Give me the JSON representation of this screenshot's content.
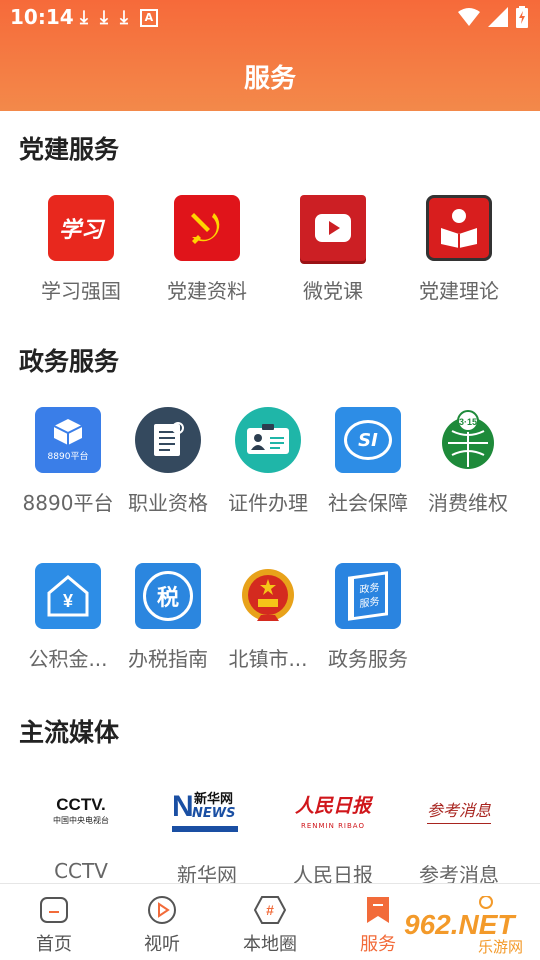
{
  "status_bar": {
    "time": "10:14"
  },
  "header": {
    "title": "服务"
  },
  "sections": [
    {
      "title": "党建服务",
      "items": [
        {
          "label": "学习强国",
          "icon": "xuexi-qiangguo-icon"
        },
        {
          "label": "党建资料",
          "icon": "party-emblem-icon"
        },
        {
          "label": "微党课",
          "icon": "video-play-icon"
        },
        {
          "label": "党建理论",
          "icon": "reading-person-icon"
        }
      ]
    },
    {
      "title": "政务服务",
      "items": [
        {
          "label": "8890平台",
          "icon": "cube-box-icon",
          "icon_text": "8890平台"
        },
        {
          "label": "职业资格",
          "icon": "certificate-doc-icon"
        },
        {
          "label": "证件办理",
          "icon": "id-card-icon"
        },
        {
          "label": "社会保障",
          "icon": "social-security-icon",
          "icon_text": "SI"
        },
        {
          "label": "消费维权",
          "icon": "consumer-rights-icon",
          "icon_text": "3·15"
        },
        {
          "label": "公积金...",
          "icon": "housing-fund-icon",
          "icon_text": "¥"
        },
        {
          "label": "办税指南",
          "icon": "tax-guide-icon",
          "icon_text": "税"
        },
        {
          "label": "北镇市...",
          "icon": "national-emblem-icon"
        },
        {
          "label": "政务服务",
          "icon": "gov-service-icon",
          "icon_text": "政务服务"
        }
      ]
    },
    {
      "title": "主流媒体",
      "items": [
        {
          "label": "CCTV",
          "icon": "cctv-logo",
          "logo_text": "CCTV.",
          "logo_sub": "中国中央电视台"
        },
        {
          "label": "新华网",
          "icon": "xinhua-logo",
          "logo_text": "新华网",
          "logo_sub": "NEWS"
        },
        {
          "label": "人民日报",
          "icon": "peoples-daily-logo",
          "logo_text": "人民日报",
          "logo_sub": "RENMIN RIBAO"
        },
        {
          "label": "参考消息",
          "icon": "cankao-xiaoxi-logo",
          "logo_text": "参考消息"
        }
      ]
    }
  ],
  "bottom_nav": [
    {
      "label": "首页",
      "active": false
    },
    {
      "label": "视听",
      "active": false
    },
    {
      "label": "本地圈",
      "active": false
    },
    {
      "label": "服务",
      "active": true
    }
  ],
  "watermark": {
    "text": "962.NET",
    "sub": "乐游网"
  },
  "colors": {
    "header_start": "#f66a3a",
    "header_end": "#f3894a",
    "accent": "#f26b3a",
    "party_red": "#d92020"
  }
}
